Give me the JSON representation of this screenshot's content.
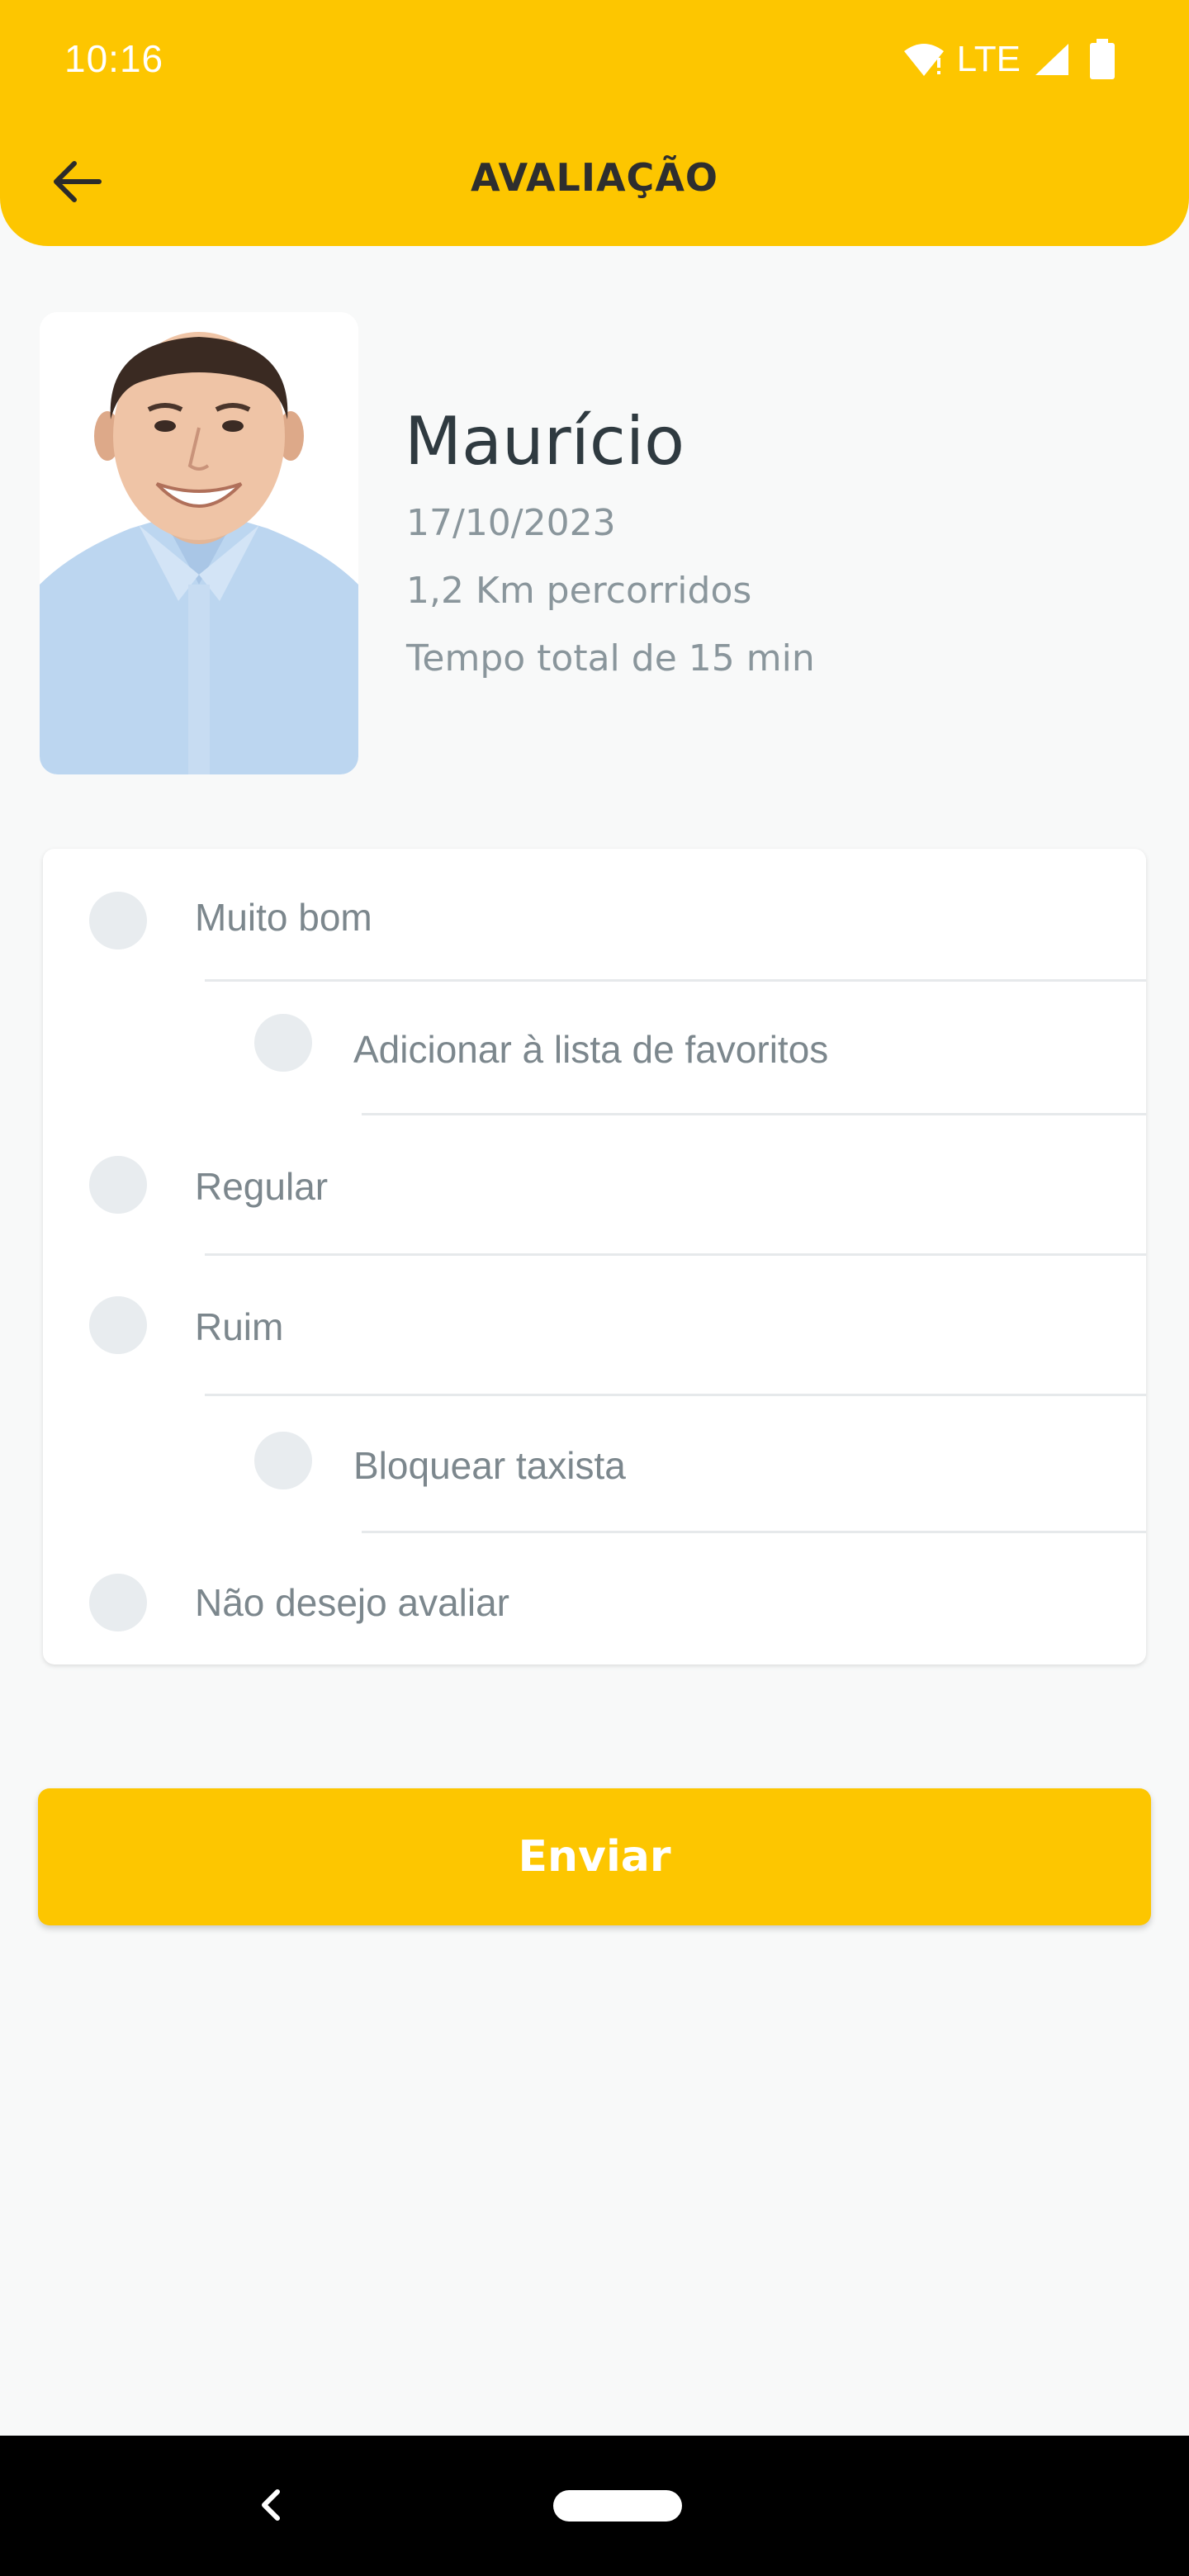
{
  "status_bar": {
    "time": "10:16",
    "network": "LTE"
  },
  "header": {
    "title": "AVALIAÇÃO",
    "back_icon": "arrow-left-icon"
  },
  "driver": {
    "name": "Maurício",
    "date": "17/10/2023",
    "distance": "1,2 Km percorridos",
    "duration": "Tempo total de 15 min"
  },
  "rating_options": [
    {
      "label": "Muito bom"
    },
    {
      "label": "Adicionar à lista de favoritos"
    },
    {
      "label": "Regular"
    },
    {
      "label": "Ruim"
    },
    {
      "label": "Bloquear taxista"
    },
    {
      "label": "Não desejo avaliar"
    }
  ],
  "submit_button": {
    "label": "Enviar"
  },
  "colors": {
    "accent": "#FDC600",
    "background": "#F8F9F9",
    "radio": "#E8ECEF"
  }
}
